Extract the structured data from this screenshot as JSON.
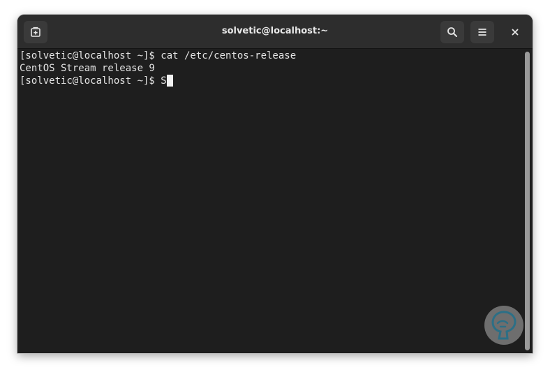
{
  "window": {
    "title": "solvetic@localhost:~"
  },
  "header": {
    "new_tab_icon": "new-tab-icon",
    "search_icon": "search-icon",
    "menu_icon": "hamburger-menu-icon",
    "close_icon": "close-icon"
  },
  "terminal": {
    "lines": [
      "[solvetic@localhost ~]$ cat /etc/centos-release",
      "CentOS Stream release 9",
      "[solvetic@localhost ~]$ S"
    ]
  },
  "colors": {
    "background": "#1e1e1e",
    "titlebar": "#2d2d2d",
    "text": "#e4e4e4",
    "logo": "#2c6f86"
  }
}
